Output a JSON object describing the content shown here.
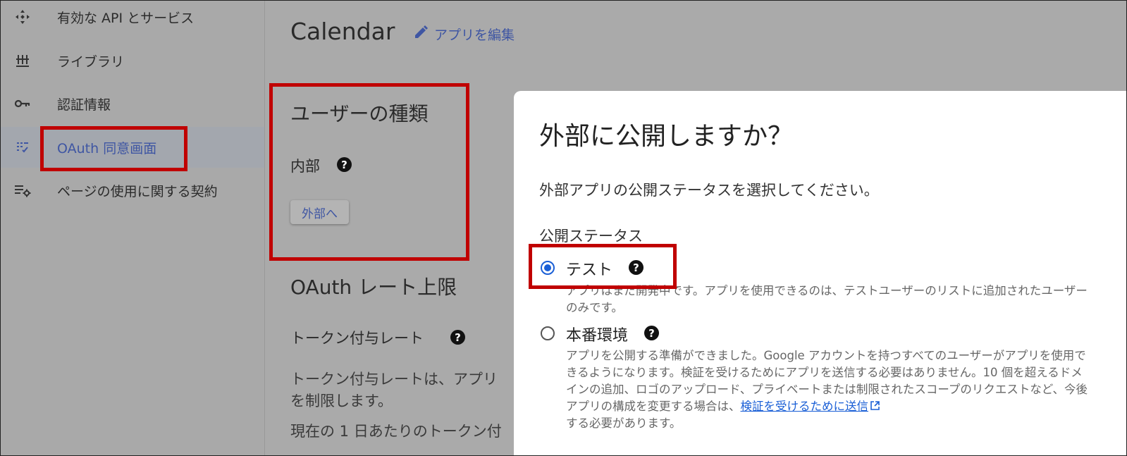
{
  "sidebar": {
    "items": [
      {
        "label": "有効な API とサービス",
        "icon": "api-icon"
      },
      {
        "label": "ライブラリ",
        "icon": "library-icon"
      },
      {
        "label": "認証情報",
        "icon": "key-icon"
      },
      {
        "label": "OAuth 同意画面",
        "icon": "consent-icon",
        "active": true
      },
      {
        "label": "ページの使用に関する契約",
        "icon": "settings-list-icon"
      }
    ]
  },
  "header": {
    "title": "Calendar",
    "edit_label": "アプリを編集",
    "edit_icon": "pencil-icon"
  },
  "user_type": {
    "heading": "ユーザーの種類",
    "value": "内部",
    "button_label": "外部へ"
  },
  "rate_limit": {
    "heading": "OAuth レート上限",
    "token_label": "トークン付与レート",
    "description_lines": [
      "トークン付与レートは、アプリ",
      "を制限します。",
      "現在の 1 日あたりのトークン付"
    ]
  },
  "dialog": {
    "title": "外部に公開しますか？",
    "description": "外部アプリの公開ステータスを選択してください。",
    "group_label": "公開ステータス",
    "options": [
      {
        "label": "テスト",
        "checked": true,
        "description": "アプリはまだ開発中です。アプリを使用できるのは、テストユーザーのリストに追加されたユーザーのみです。"
      },
      {
        "label": "本番環境",
        "checked": false,
        "description_before": "アプリを公開する準備ができました。Google アカウントを持つすべてのユーザーがアプリを使用できるようになります。検証を受けるためにアプリを送信する必要はありません。10 個を超えるドメインの追加、ロゴのアップロード、プライベートまたは制限されたスコープのリクエストなど、今後アプリの構成を変更する場合は、",
        "link_text": "検証を受けるために送信",
        "description_after": "する必要があります。"
      }
    ]
  },
  "colors": {
    "highlight": "#c00000",
    "accent": "#1a5fd6",
    "overlay": "#aaaaaa"
  }
}
